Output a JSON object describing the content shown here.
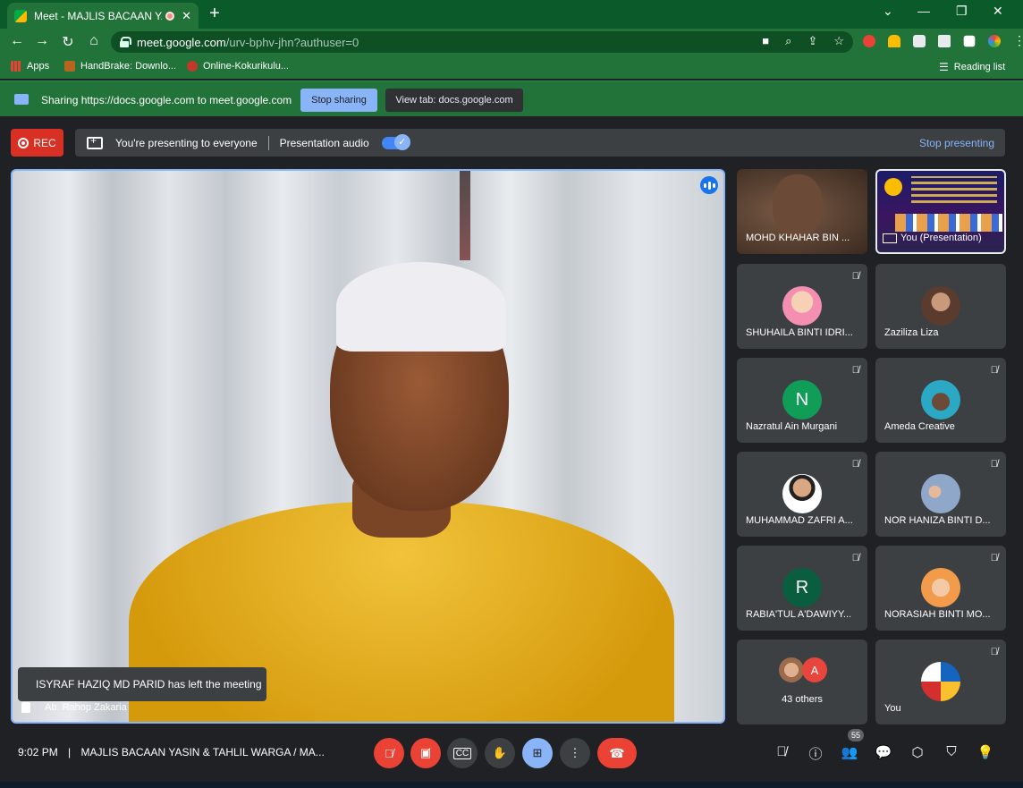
{
  "browser": {
    "tab_title": "Meet - MAJLIS BACAAN YAS",
    "url_host": "meet.google.com",
    "url_path": "/urv-bphv-jhn?authuser=0",
    "bookmarks": [
      {
        "label": "Apps",
        "icon": "apps-grid-icon"
      },
      {
        "label": "HandBrake: Downlo...",
        "icon": "handbrake-icon"
      },
      {
        "label": "Online-Kokurikulu...",
        "icon": "kokurikulum-icon"
      }
    ],
    "reading_list": "Reading list"
  },
  "sharing_bar": {
    "text": "Sharing https://docs.google.com to meet.google.com",
    "stop_label": "Stop sharing",
    "view_tab_label": "View tab: docs.google.com"
  },
  "meet": {
    "rec_label": "REC",
    "presenting_text": "You're presenting to everyone",
    "audio_label": "Presentation audio",
    "stop_presenting": "Stop presenting",
    "toast": "ISYRAF HAZIQ MD PARID has left the meeting",
    "main_speaker": "Ab. Rahop Zakaria",
    "tiles": [
      {
        "name": "MOHD KHAHAR BIN ...",
        "kind": "video"
      },
      {
        "name": "You (Presentation)",
        "kind": "presentation"
      },
      {
        "name": "SHUHAILA BINTI IDRI...",
        "kind": "photo",
        "muted": true
      },
      {
        "name": "Zaziliza Liza",
        "kind": "photo",
        "muted": false
      },
      {
        "name": "Nazratul Ain Murgani",
        "kind": "letter",
        "letter": "N",
        "color": "#0f9d58",
        "muted": true
      },
      {
        "name": "Ameda Creative",
        "kind": "photo",
        "muted": true
      },
      {
        "name": "MUHAMMAD ZAFRI A...",
        "kind": "photo",
        "muted": true
      },
      {
        "name": "NOR HANIZA BINTI D...",
        "kind": "photo",
        "muted": true
      },
      {
        "name": "RABIA'TUL A'DAWIYY...",
        "kind": "letter",
        "letter": "R",
        "color": "#0b5d3f",
        "muted": true
      },
      {
        "name": "NORASIAH BINTI MO...",
        "kind": "photo",
        "muted": true
      },
      {
        "name": "43 others",
        "kind": "others",
        "letter": "A"
      },
      {
        "name": "You",
        "kind": "photo",
        "muted": true
      }
    ],
    "bottom": {
      "time": "9:02 PM",
      "separator": "|",
      "meeting_title": "MAJLIS BACAAN YASIN & TAHLIL WARGA / MA...",
      "people_count": "55"
    }
  }
}
